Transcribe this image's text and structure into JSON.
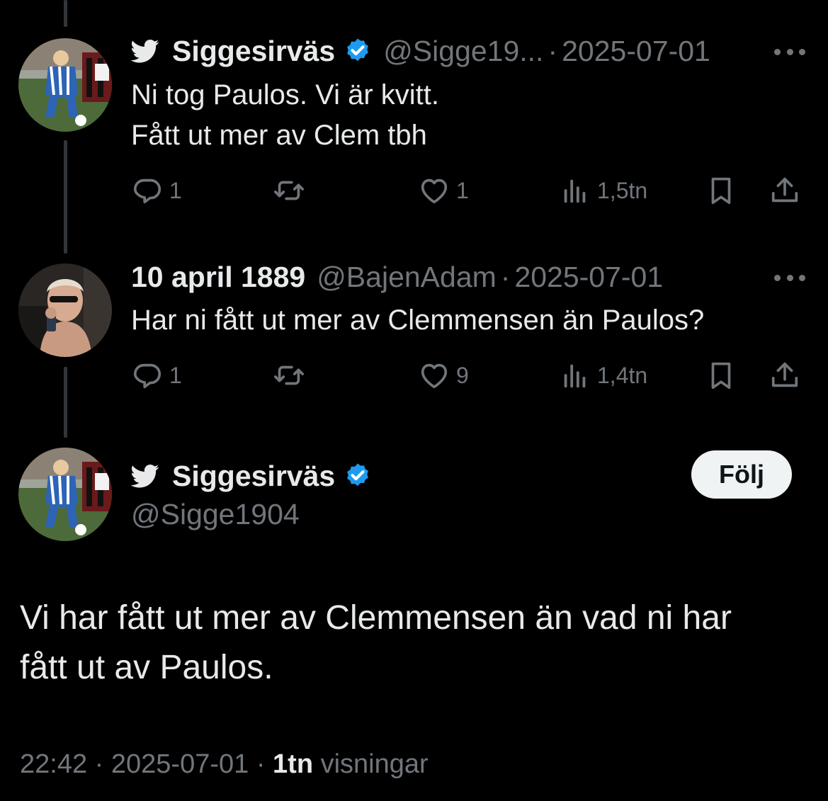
{
  "tweets": [
    {
      "name": "Siggesirväs",
      "handle": "@Sigge19...",
      "date": "2025-07-01",
      "lines": [
        "Ni tog Paulos. Vi är kvitt.",
        "Fått ut mer av Clem tbh"
      ],
      "replies": "1",
      "retweets": "",
      "likes": "1",
      "views": "1,5tn"
    },
    {
      "name": "10 april 1889",
      "handle": "@BajenAdam",
      "date": "2025-07-01",
      "lines": [
        "Har ni fått ut mer av Clemmensen än Paulos?"
      ],
      "replies": "1",
      "retweets": "",
      "likes": "9",
      "views": "1,4tn"
    }
  ],
  "main_tweet": {
    "name": "Siggesirväs",
    "handle": "@Sigge1904",
    "follow_label": "Följ",
    "lines": [
      "Vi har fått ut mer av Clemmensen än vad ni har",
      "fått ut av Paulos."
    ],
    "time": "22:42",
    "date": "2025-07-01",
    "views_count": "1tn",
    "views_label": "visningar"
  },
  "separator": "·",
  "icons": {
    "bird": "twitter-bird-icon",
    "verified": "verified-badge-icon",
    "more": "more-dots-icon",
    "reply": "reply-icon",
    "retweet": "retweet-icon",
    "like": "like-icon",
    "views": "views-icon",
    "bookmark": "bookmark-icon",
    "share": "share-icon"
  },
  "colors": {
    "background": "#000000",
    "text": "#e7e9ea",
    "muted": "#71767b",
    "verified": "#1d9bf0",
    "thread_line": "#333639",
    "follow_bg": "#eff3f4"
  }
}
